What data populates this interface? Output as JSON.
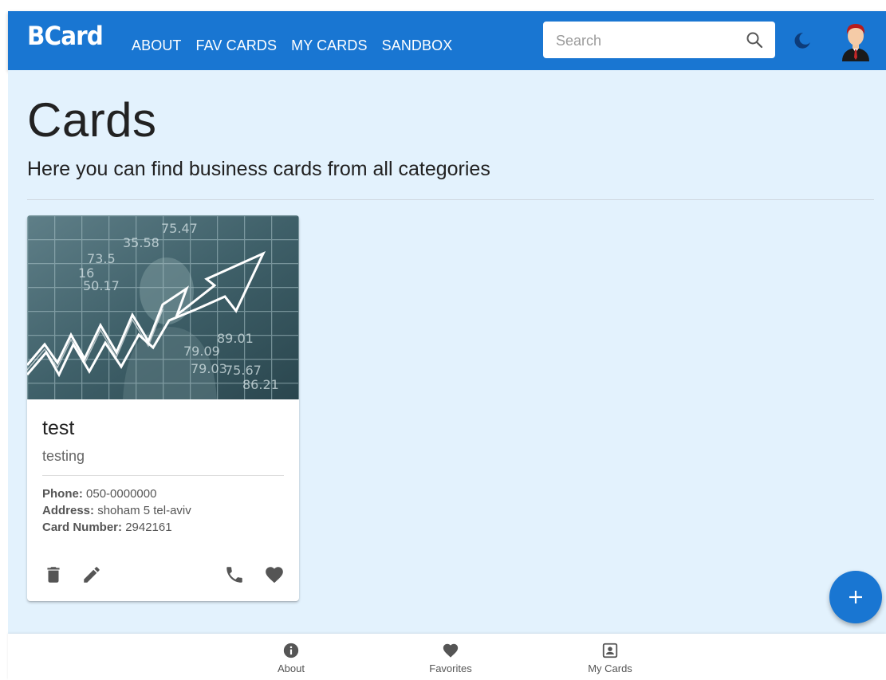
{
  "app": {
    "logo": "BCard",
    "nav": [
      "ABOUT",
      "FAV CARDS",
      "MY CARDS",
      "SANDBOX"
    ]
  },
  "search": {
    "placeholder": "Search",
    "value": ""
  },
  "page": {
    "title": "Cards",
    "subtitle": "Here you can find business cards from all categories"
  },
  "cards": [
    {
      "title": "test",
      "subtitle": "testing",
      "phone_label": "Phone:",
      "phone": "050-0000000",
      "address_label": "Address:",
      "address": "shoham 5 tel-aviv",
      "card_number_label": "Card Number:",
      "card_number": "2942161",
      "image_numbers": [
        "35.58",
        "75.47",
        "73.5",
        "16",
        "50.17",
        "79.09",
        "89.01",
        "75.67",
        "86.21",
        "79.03"
      ]
    }
  ],
  "bottom_nav": [
    {
      "label": "About",
      "icon": "info-icon"
    },
    {
      "label": "Favorites",
      "icon": "heart-icon"
    },
    {
      "label": "My Cards",
      "icon": "portrait-icon"
    }
  ],
  "colors": {
    "primary": "#1976d2",
    "background": "#e3f2fd",
    "icon": "#555555"
  },
  "icons": {
    "search": "search-icon",
    "theme": "dark-mode-moon-icon",
    "avatar": "user-avatar",
    "card_actions_left": [
      "trash-icon",
      "pencil-icon"
    ],
    "card_actions_right": [
      "phone-icon",
      "heart-icon"
    ],
    "fab": "plus-icon"
  }
}
